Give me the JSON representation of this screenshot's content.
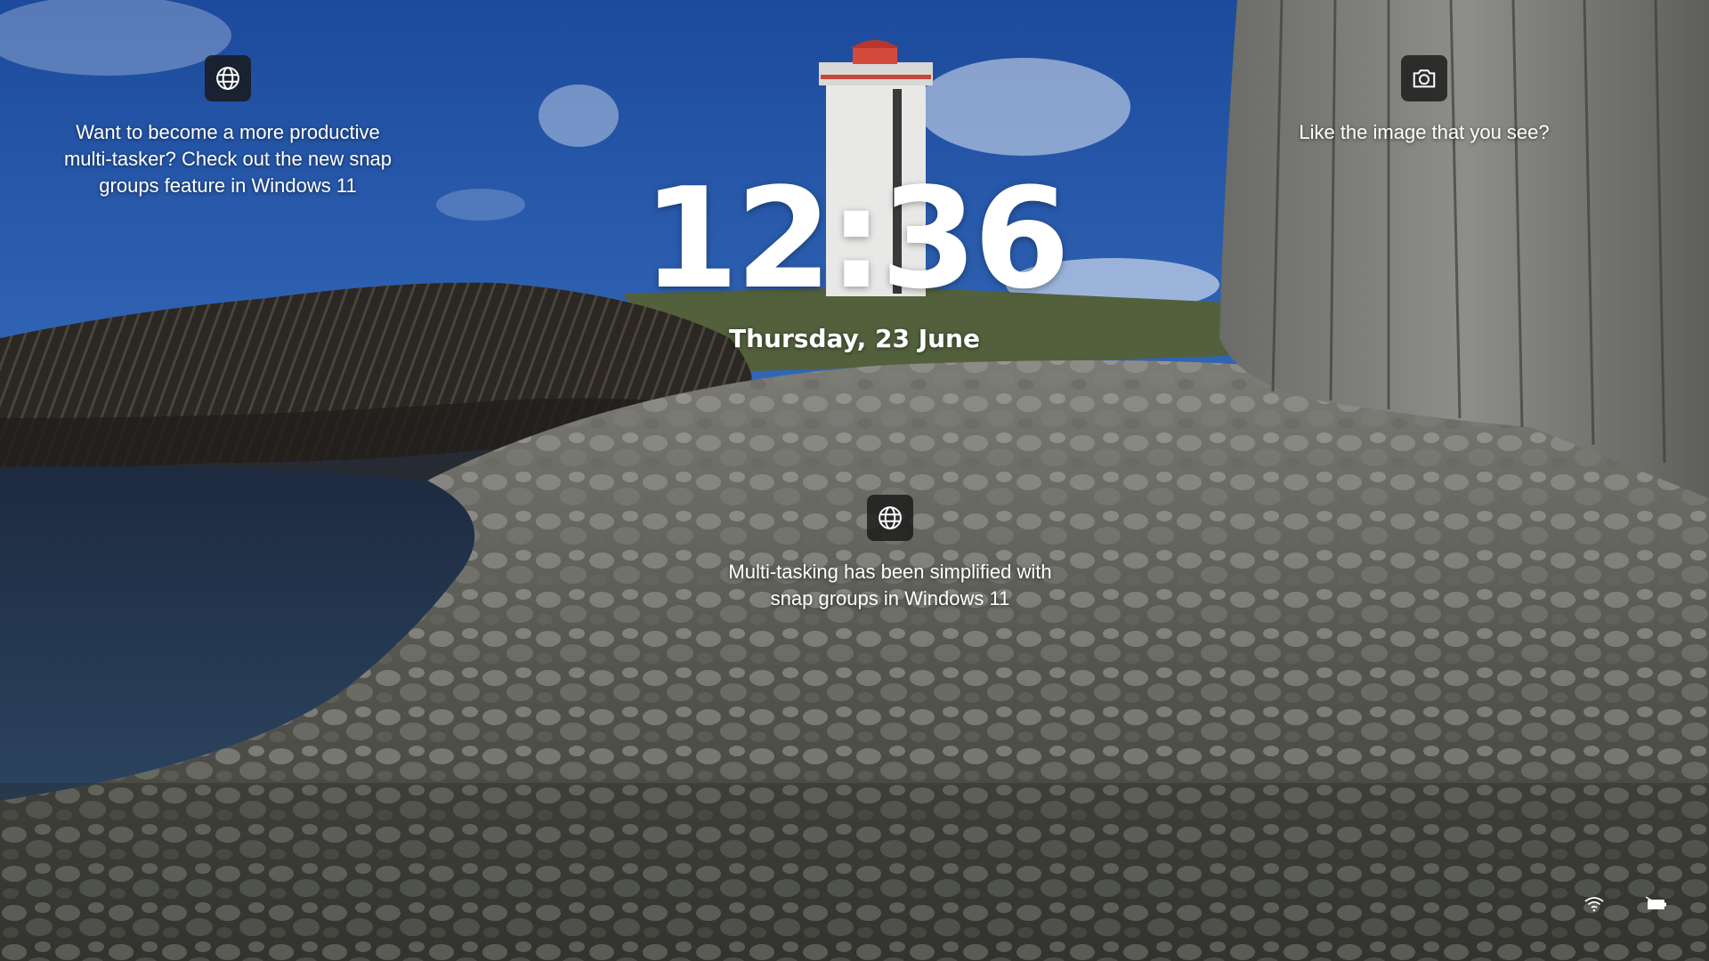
{
  "lock_screen": {
    "time": "12:36",
    "date": "Thursday, 23 June"
  },
  "tips": {
    "top_left": {
      "icon": "globe-icon",
      "text_line1": "Want to become a more productive",
      "text_line2": "multi-tasker? Check out the new snap",
      "text_line3": "groups feature in Windows 11"
    },
    "top_right": {
      "icon": "camera-icon",
      "text_line1": "Like the image that you see?"
    },
    "center": {
      "icon": "globe-icon",
      "text_line1": "Multi-tasking has been simplified with",
      "text_line2": "snap groups in Windows 11"
    }
  },
  "status": {
    "network_icon": "wifi-icon",
    "battery_icon": "battery-charging-icon"
  },
  "colors": {
    "sky_top": "#1f4f9e",
    "sky_bottom": "#6f9fd6",
    "rock_dark": "#2a2622",
    "rock_light": "#8c8c88",
    "tip_icon_bg": "#1b1b1b"
  }
}
